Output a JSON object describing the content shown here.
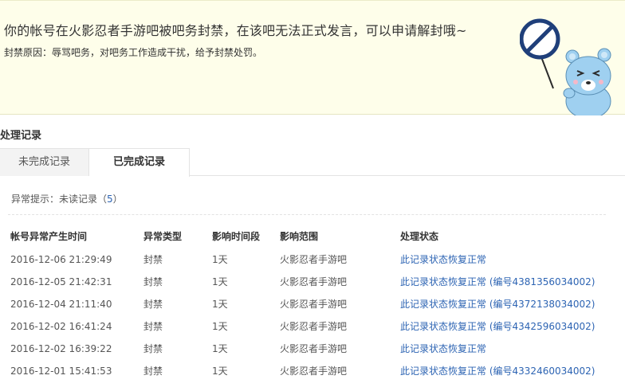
{
  "ban_notice": {
    "title": "你的帐号在火影忍者手游吧被吧务封禁，在该吧无法正式发言，可以申请解封哦~",
    "reason_label": "封禁原因：",
    "reason_text": "辱骂吧务，对吧务工作造成干扰，给予封禁处罚。"
  },
  "section_title": "处理记录",
  "tabs": [
    {
      "label": "未完成记录",
      "active": false
    },
    {
      "label": "已完成记录",
      "active": true
    }
  ],
  "tip": {
    "label": "异常提示：未读记录（",
    "count": "5",
    "suffix": "）"
  },
  "table": {
    "headers": [
      "帐号异常产生时间",
      "异常类型",
      "影响时间段",
      "影响范围",
      "处理状态"
    ],
    "rows": [
      {
        "time": "2016-12-06 21:29:49",
        "type": "封禁",
        "duration": "1天",
        "scope": "火影忍者手游吧",
        "status": "此记录状态恢复正常",
        "ref": ""
      },
      {
        "time": "2016-12-05 21:42:31",
        "type": "封禁",
        "duration": "1天",
        "scope": "火影忍者手游吧",
        "status": "此记录状态恢复正常",
        "ref": "(编号4381356034002)"
      },
      {
        "time": "2016-12-04 21:11:40",
        "type": "封禁",
        "duration": "1天",
        "scope": "火影忍者手游吧",
        "status": "此记录状态恢复正常",
        "ref": "(编号4372138034002)"
      },
      {
        "time": "2016-12-02 16:41:24",
        "type": "封禁",
        "duration": "1天",
        "scope": "火影忍者手游吧",
        "status": "此记录状态恢复正常",
        "ref": "(编号4342596034002)"
      },
      {
        "time": "2016-12-02 16:39:22",
        "type": "封禁",
        "duration": "1天",
        "scope": "火影忍者手游吧",
        "status": "此记录状态恢复正常",
        "ref": ""
      },
      {
        "time": "2016-12-01 15:41:53",
        "type": "封禁",
        "duration": "1天",
        "scope": "火影忍者手游吧",
        "status": "此记录状态恢复正常",
        "ref": "(编号4332460034002)"
      }
    ]
  },
  "colors": {
    "banner_bg": "#fefeea",
    "link": "#2d64b3",
    "mascot_body": "#9fd0f0",
    "sign_bg": "#ffffff",
    "sign_border": "#1f3f7a"
  },
  "icons": {
    "mascot": "no-entry-sign-bear-icon"
  }
}
